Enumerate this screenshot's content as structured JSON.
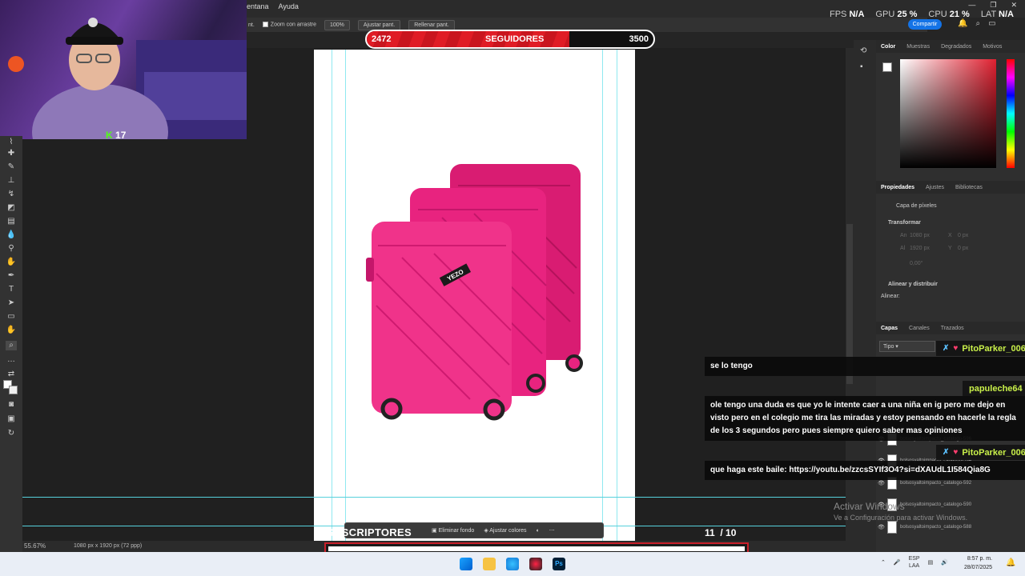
{
  "menu": {
    "items": [
      "entana",
      "Ayuda"
    ]
  },
  "options_bar": {
    "prev": "nt.",
    "zoom_drag": "Zoom con arrastre",
    "zoom_pct": "100%",
    "fit": "Ajustar pant.",
    "fill": "Rellenar pant."
  },
  "stats": {
    "fps_label": "FPS",
    "fps_val": "N/A",
    "gpu_label": "GPU",
    "gpu_val": "25",
    "gpu_unit": "%",
    "cpu_label": "CPU",
    "cpu_val": "21",
    "cpu_unit": "%",
    "lat_label": "LAT",
    "lat_val": "N/A"
  },
  "share_label": "Compartir",
  "followers": {
    "current": "2472",
    "title": "SEGUIDORES",
    "goal": "3500",
    "progress": 0.7063
  },
  "webcam": {
    "kick_number": "17",
    "kick_letter": "K"
  },
  "panels": {
    "color_tabs": [
      "Color",
      "Muestras",
      "Degradados",
      "Motivos"
    ],
    "props_tabs": [
      "Propiedades",
      "Ajustes",
      "Bibliotecas"
    ],
    "pixel_layer": "Capa de píxeles",
    "transform": "Transformar",
    "field_w_label": "An",
    "field_w": "1080 px",
    "field_h_label": "Al",
    "field_h": "1920 px",
    "field_x_label": "X",
    "field_x": "0 px",
    "field_y_label": "Y",
    "field_y": "0 px",
    "angle": "0,00°",
    "align": "Alinear y distribuir",
    "align_sub": "Alinear:",
    "layer_tabs": [
      "Capas",
      "Canales",
      "Trazados"
    ],
    "kind": "Tipo",
    "layers": [
      "bolsosyaltoimpacto_catalogo-596",
      "bolsosyaltoimpacto_catalogo-594",
      "bolsosyaltoimpacto_catalogo-592",
      "bolsosyaltoimpacto_catalogo-590",
      "bolsosyaltoimpacto_catalogo-588"
    ]
  },
  "chat": [
    {
      "user": "PitoParker_006",
      "message": "se lo tengo",
      "color": "#c9f04a"
    },
    {
      "user": "papuleche64",
      "message": "ole tengo una duda es que yo le intente caer a una niña en ig pero me dejo en visto pero en el colegio me tira las miradas y estoy pensando en hacerle la regla de los 3 segundos pero pues siempre quiero saber mas opiniones",
      "color": "#c9f04a"
    },
    {
      "user": "PitoParker_006",
      "message": "que haga este baile: https://youtu.be/zzcsSYIf3O4?si=dXAUdL1I584Qia8G",
      "color": "#c9f04a"
    }
  ],
  "product_brand": "YEZO",
  "status": {
    "zoom": "55.67%",
    "doc_info": "1080 px x 1920 px (72 ppp)"
  },
  "subscribers": {
    "label": "SUSCRIPTORES",
    "current": "11",
    "goal": "/ 10",
    "progress": 1.0
  },
  "context_bar": {
    "remove_bg": "Eliminar fondo",
    "adjust": "Ajustar colores"
  },
  "watermark": {
    "title": "Activar Windows",
    "subtitle": "Ve a Configuración para activar Windows."
  },
  "tray": {
    "lang": "ESP",
    "layout": "LAA",
    "time": "8:57 p. m.",
    "date": "28/07/2025"
  },
  "colors": {
    "accent_red": "#e01c25",
    "chat_name": "#c9f04a",
    "suitcase": "#e8237f",
    "share": "#1473e6"
  }
}
